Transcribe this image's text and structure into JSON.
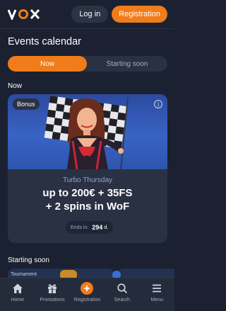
{
  "header": {
    "logo_text": "VOX",
    "login_label": "Log in",
    "register_label": "Registration"
  },
  "page_title": "Events calendar",
  "tabs": [
    {
      "label": "Now",
      "active": true
    },
    {
      "label": "Starting soon",
      "active": false
    }
  ],
  "sections": {
    "now_label": "Now",
    "starting_soon_label": "Starting soon"
  },
  "promo_card": {
    "badge": "Bonus",
    "subtitle": "Turbo Thursday",
    "headline_line1": "up to 200€ + 35FS",
    "headline_line2": "+ 2 spins in WoF",
    "ends_label": "Ends in:",
    "ends_value": "294",
    "ends_unit": "d."
  },
  "peek_card": {
    "badge": "Tournament"
  },
  "bottom_nav": [
    {
      "label": "Home",
      "icon": "home-icon"
    },
    {
      "label": "Promotions",
      "icon": "gift-icon"
    },
    {
      "label": "Registration",
      "icon": "plus-icon"
    },
    {
      "label": "Search",
      "icon": "search-icon"
    },
    {
      "label": "Menu",
      "icon": "menu-icon"
    }
  ],
  "colors": {
    "accent": "#f07c1a",
    "background": "#1b2130",
    "card": "#2a3142",
    "subtitle": "#8ea2d9"
  }
}
